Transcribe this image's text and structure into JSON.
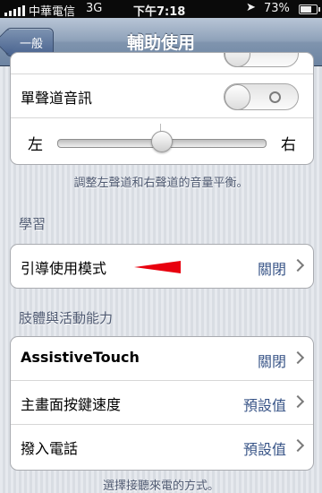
{
  "status_bar": {
    "carrier": "中華電信",
    "network": "3G",
    "time": "下午7:18",
    "battery": "73%",
    "battery_level": 0.73
  },
  "nav": {
    "back_label": "一般",
    "title": "輔助使用"
  },
  "audio_group": {
    "mono_audio_label": "單聲道音訊",
    "mono_audio_on": false,
    "balance_left": "左",
    "balance_right": "右",
    "balance_value": 0.5,
    "balance_footnote": "調整左聲道和右聲道的音量平衡。"
  },
  "learning_section": {
    "header": "學習",
    "guided_access_label": "引導使用模式",
    "guided_access_value": "關閉"
  },
  "physical_section": {
    "header": "肢體與活動能力",
    "assistive_touch_label": "AssistiveTouch",
    "assistive_touch_value": "關閉",
    "home_click_speed_label": "主畫面按鍵速度",
    "home_click_speed_value": "預設值",
    "incoming_calls_label": "撥入電話",
    "incoming_calls_value": "預設值",
    "partial_footnote": "選擇接聽來電的方式。"
  },
  "annotation_color": "#e8000e"
}
